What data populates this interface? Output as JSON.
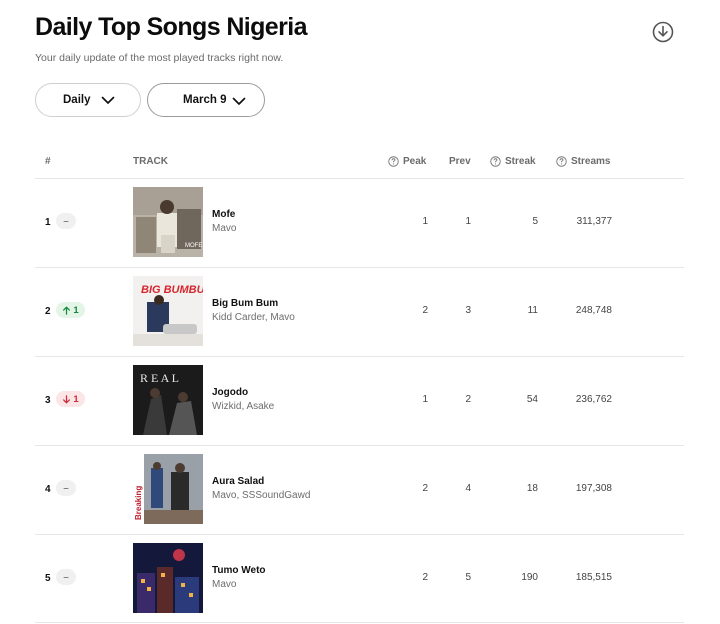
{
  "header": {
    "title": "Daily Top Songs Nigeria",
    "subtitle": "Your daily update of the most played tracks right now.",
    "download_icon": "download-circle-icon"
  },
  "filters": {
    "period": "Daily",
    "date": "March 9"
  },
  "table": {
    "columns": {
      "rank": "#",
      "track": "TRACK",
      "peak": "Peak",
      "prev": "Prev",
      "streak": "Streak",
      "streams": "Streams"
    },
    "rows": [
      {
        "rank": "1",
        "change": "–",
        "change_dir": "same",
        "title": "Mofe",
        "artists": "Mavo",
        "peak": "1",
        "prev": "1",
        "streak": "5",
        "streams": "311,377"
      },
      {
        "rank": "2",
        "change": "1",
        "change_dir": "up",
        "title": "Big Bum Bum",
        "artists": "Kidd Carder, Mavo",
        "peak": "2",
        "prev": "3",
        "streak": "11",
        "streams": "248,748"
      },
      {
        "rank": "3",
        "change": "1",
        "change_dir": "down",
        "title": "Jogodo",
        "artists": "Wizkid, Asake",
        "peak": "1",
        "prev": "2",
        "streak": "54",
        "streams": "236,762"
      },
      {
        "rank": "4",
        "change": "–",
        "change_dir": "same",
        "title": "Aura Salad",
        "artists": "Mavo, SSSoundGawd",
        "peak": "2",
        "prev": "4",
        "streak": "18",
        "streams": "197,308"
      },
      {
        "rank": "5",
        "change": "–",
        "change_dir": "same",
        "title": "Tumo Weto",
        "artists": "Mavo",
        "peak": "2",
        "prev": "5",
        "streak": "190",
        "streams": "185,515"
      }
    ]
  },
  "artwork_text": {
    "mofe": "MOFE",
    "bigbumbum": "BIG BUMBUM",
    "jogodo": "R E A L",
    "aura": "Breaking"
  },
  "colors": {
    "up": "#15883e",
    "down": "#d22b3a",
    "chip_up_bg": "#e3f5e6",
    "chip_down_bg": "#fbe5e7"
  }
}
